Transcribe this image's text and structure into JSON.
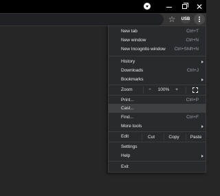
{
  "menu": {
    "new_tab": {
      "label": "New tab",
      "shortcut": "Ctrl+T"
    },
    "new_window": {
      "label": "New window",
      "shortcut": "Ctrl+N"
    },
    "new_incognito": {
      "label": "New Incognito window",
      "shortcut": "Ctrl+Shift+N"
    },
    "history": {
      "label": "History"
    },
    "downloads": {
      "label": "Downloads",
      "shortcut": "Ctrl+J"
    },
    "bookmarks": {
      "label": "Bookmarks"
    },
    "zoom": {
      "label": "Zoom",
      "minus": "−",
      "value": "100%",
      "plus": "+"
    },
    "print": {
      "label": "Print...",
      "shortcut": "Ctrl+P"
    },
    "cast": {
      "label": "Cast..."
    },
    "find": {
      "label": "Find...",
      "shortcut": "Ctrl+F"
    },
    "more_tools": {
      "label": "More tools"
    },
    "edit": {
      "label": "Edit",
      "cut": "Cut",
      "copy": "Copy",
      "paste": "Paste"
    },
    "settings": {
      "label": "Settings"
    },
    "help": {
      "label": "Help"
    },
    "exit": {
      "label": "Exit"
    }
  },
  "toolbar": {
    "profile_label": "USB"
  },
  "icons": {
    "star": "star-icon",
    "kebab": "more-vert-icon",
    "fullscreen": "fullscreen-icon",
    "minimize": "minimize-icon",
    "restore": "restore-icon",
    "close": "close-icon",
    "arrow": "chevron-right-icon"
  },
  "colors": {
    "menu_bg": "#292a2d",
    "highlight": "#3f4042",
    "page_bg": "#262626"
  }
}
